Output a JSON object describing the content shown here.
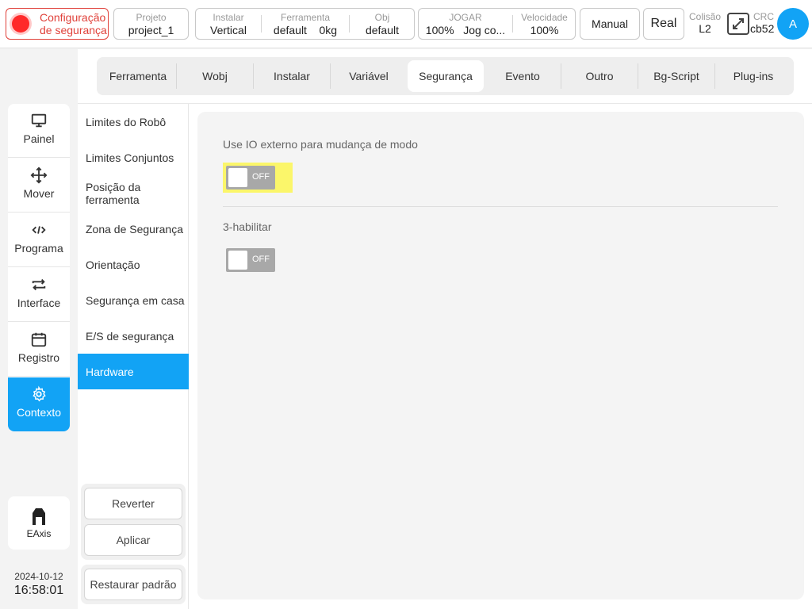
{
  "topbar": {
    "safety_label_line1": "Configuração",
    "safety_label_line2": "de segurança",
    "project_key": "Projeto",
    "project_value": "project_1",
    "install_key": "Instalar",
    "install_value": "Vertical",
    "tool_key": "Ferramenta",
    "tool_value": "default    0kg",
    "obj_key": "Obj",
    "obj_value": "default",
    "jog_key": "JOGAR",
    "jog_value": "100%   Jog co...",
    "speed_key": "Velocidade",
    "speed_value": "100%",
    "manual_label": "Manual",
    "real_label": "Real",
    "collision_key": "Colisão",
    "collision_value": "L2",
    "crc_key": "CRC",
    "crc_value": "cb52",
    "avatar_letter": "A",
    "accent_color": "#12a3f5",
    "safety_color": "#e0413a"
  },
  "leftnav": {
    "items": [
      {
        "label": "Painel",
        "icon": "monitor-icon"
      },
      {
        "label": "Mover",
        "icon": "move-arrows-icon"
      },
      {
        "label": "Programa",
        "icon": "code-icon"
      },
      {
        "label": "Interface",
        "icon": "swap-arrows-icon"
      },
      {
        "label": "Registro",
        "icon": "calendar-icon"
      },
      {
        "label": "Contexto",
        "icon": "gear-icon"
      }
    ],
    "active": "Contexto",
    "eaxis_label": "EAxis",
    "date": "2024-10-12",
    "time": "16:58:01"
  },
  "tabs": {
    "items": [
      "Ferramenta",
      "Wobj",
      "Instalar",
      "Variável",
      "Segurança",
      "Evento",
      "Outro",
      "Bg-Script",
      "Plug-ins"
    ],
    "active": "Segurança"
  },
  "submenu": {
    "items": [
      "Limites do Robô",
      "Limites Conjuntos",
      "Posição da ferramenta",
      "Zona de Segurança",
      "Orientação",
      "Segurança em casa",
      "E/S de segurança",
      "Hardware"
    ],
    "active": "Hardware",
    "revert_label": "Reverter",
    "apply_label": "Aplicar",
    "restore_label": "Restaurar padrão"
  },
  "panel": {
    "external_io_label": "Use IO externo para mudança de modo",
    "external_io_state": "OFF",
    "three_enable_label": "3-habilitar",
    "three_enable_state": "OFF",
    "highlight_color": "#fbf66a"
  }
}
